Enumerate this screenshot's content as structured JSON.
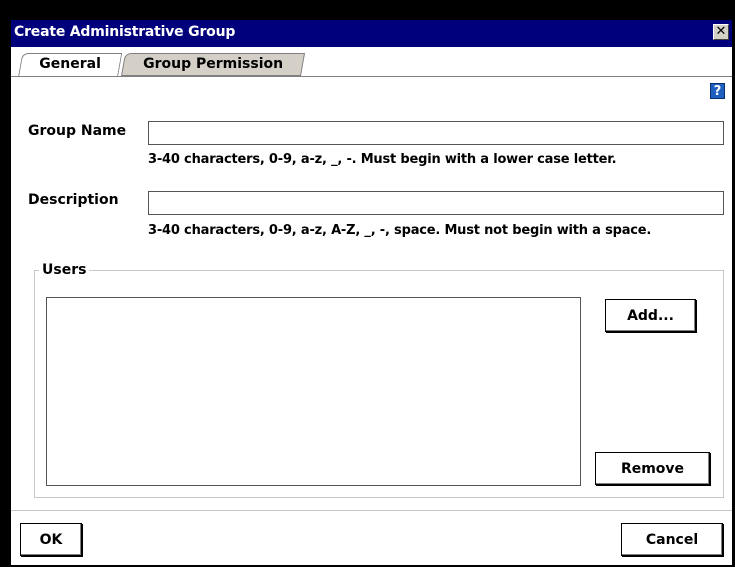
{
  "window": {
    "title": "Create Administrative Group",
    "close_glyph": "✕"
  },
  "tabs": [
    {
      "label": "General",
      "active": true
    },
    {
      "label": "Group Permission",
      "active": false
    }
  ],
  "help": {
    "glyph": "?"
  },
  "form": {
    "group_name": {
      "label": "Group Name",
      "value": "",
      "hint": "3-40 characters, 0-9, a-z, _, -. Must begin with a lower case letter."
    },
    "description": {
      "label": "Description",
      "value": "",
      "hint": "3-40 characters, 0-9, a-z, A-Z, _, -, space. Must not begin with a space."
    }
  },
  "users": {
    "legend": "Users",
    "items": [],
    "add_label": "Add...",
    "remove_label": "Remove"
  },
  "footer": {
    "ok_label": "OK",
    "cancel_label": "Cancel"
  },
  "colors": {
    "titlebar": "#00007c",
    "help_icon": "#1f5fbf",
    "inactive_tab": "#d4d0c8"
  }
}
